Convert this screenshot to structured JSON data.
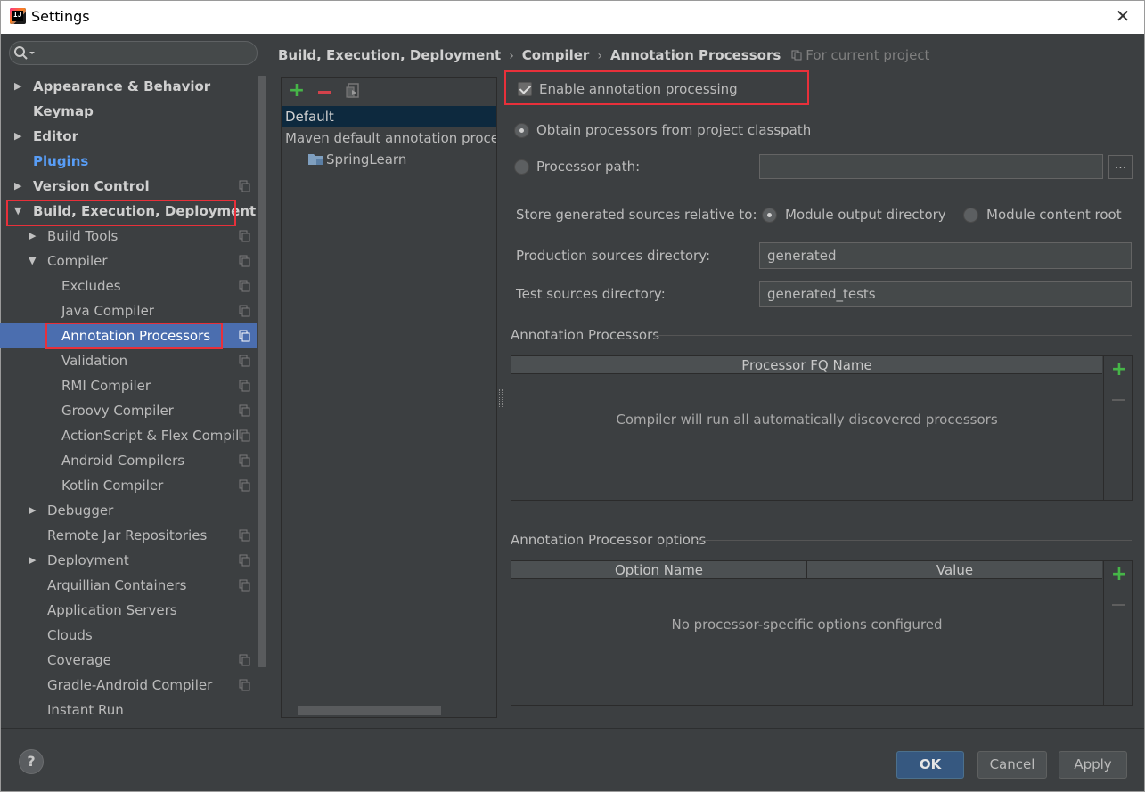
{
  "window": {
    "title": "Settings",
    "close_glyph": "✕"
  },
  "search": {
    "placeholder": "",
    "icon": "search-icon"
  },
  "sidebar": {
    "items": [
      {
        "label": "Appearance & Behavior",
        "level": 0,
        "arrow": "right",
        "style": "bold",
        "copy": false
      },
      {
        "label": "Keymap",
        "level": 0,
        "arrow": "none",
        "style": "bold",
        "copy": false
      },
      {
        "label": "Editor",
        "level": 0,
        "arrow": "right",
        "style": "bold",
        "copy": false
      },
      {
        "label": "Plugins",
        "level": 0,
        "arrow": "none",
        "style": "link",
        "copy": false
      },
      {
        "label": "Version Control",
        "level": 0,
        "arrow": "right",
        "style": "bold",
        "copy": true
      },
      {
        "label": "Build, Execution, Deployment",
        "level": 0,
        "arrow": "down",
        "style": "bold",
        "copy": false
      },
      {
        "label": "Build Tools",
        "level": 1,
        "arrow": "right",
        "style": "normal",
        "copy": true
      },
      {
        "label": "Compiler",
        "level": 1,
        "arrow": "down",
        "style": "normal",
        "copy": true
      },
      {
        "label": "Excludes",
        "level": 2,
        "arrow": "none",
        "style": "normal",
        "copy": true
      },
      {
        "label": "Java Compiler",
        "level": 2,
        "arrow": "none",
        "style": "normal",
        "copy": true
      },
      {
        "label": "Annotation Processors",
        "level": 2,
        "arrow": "none",
        "style": "normal",
        "copy": true,
        "selected": true
      },
      {
        "label": "Validation",
        "level": 2,
        "arrow": "none",
        "style": "normal",
        "copy": true
      },
      {
        "label": "RMI Compiler",
        "level": 2,
        "arrow": "none",
        "style": "normal",
        "copy": true
      },
      {
        "label": "Groovy Compiler",
        "level": 2,
        "arrow": "none",
        "style": "normal",
        "copy": true
      },
      {
        "label": "ActionScript & Flex Compil",
        "level": 2,
        "arrow": "none",
        "style": "normal",
        "copy": true
      },
      {
        "label": "Android Compilers",
        "level": 2,
        "arrow": "none",
        "style": "normal",
        "copy": true
      },
      {
        "label": "Kotlin Compiler",
        "level": 2,
        "arrow": "none",
        "style": "normal",
        "copy": true
      },
      {
        "label": "Debugger",
        "level": 1,
        "arrow": "right",
        "style": "normal",
        "copy": false
      },
      {
        "label": "Remote Jar Repositories",
        "level": 1,
        "arrow": "none",
        "style": "normal",
        "copy": true
      },
      {
        "label": "Deployment",
        "level": 1,
        "arrow": "right",
        "style": "normal",
        "copy": true
      },
      {
        "label": "Arquillian Containers",
        "level": 1,
        "arrow": "none",
        "style": "normal",
        "copy": true
      },
      {
        "label": "Application Servers",
        "level": 1,
        "arrow": "none",
        "style": "normal",
        "copy": false
      },
      {
        "label": "Clouds",
        "level": 1,
        "arrow": "none",
        "style": "normal",
        "copy": false
      },
      {
        "label": "Coverage",
        "level": 1,
        "arrow": "none",
        "style": "normal",
        "copy": true
      },
      {
        "label": "Gradle-Android Compiler",
        "level": 1,
        "arrow": "none",
        "style": "normal",
        "copy": true
      },
      {
        "label": "Instant Run",
        "level": 1,
        "arrow": "none",
        "style": "normal",
        "copy": false
      }
    ]
  },
  "breadcrumb": {
    "parts": [
      "Build, Execution, Deployment",
      "Compiler",
      "Annotation Processors"
    ],
    "separator": "›",
    "scope": "For current project"
  },
  "profiles": {
    "items": [
      "Default",
      "Maven default annotation processors profile",
      "SpringLearn"
    ],
    "selected": "Default"
  },
  "settings": {
    "enable_label": "Enable annotation processing",
    "enable_checked": true,
    "obtain_label": "Obtain processors from project classpath",
    "path_label": "Processor path:",
    "path_value": "",
    "path_browse": "...",
    "store_label": "Store generated sources relative to:",
    "store_opt1": "Module output directory",
    "store_opt2": "Module content root",
    "prod_label": "Production sources directory:",
    "prod_value": "generated",
    "test_label": "Test sources directory:",
    "test_value": "generated_tests"
  },
  "processors_table": {
    "section": "Annotation Processors",
    "columns": [
      "Processor FQ Name"
    ],
    "empty_text": "Compiler will run all automatically discovered processors"
  },
  "options_table": {
    "section": "Annotation Processor options",
    "columns": [
      "Option Name",
      "Value"
    ],
    "empty_text": "No processor-specific options configured"
  },
  "buttons": {
    "help": "?",
    "ok": "OK",
    "cancel": "Cancel",
    "apply": "Apply"
  },
  "colors": {
    "background": "#3c3f41",
    "selection": "#4b6eaf",
    "highlight_box": "#e8303a",
    "add": "#46b548",
    "remove": "#d3424b",
    "link": "#589df6"
  }
}
